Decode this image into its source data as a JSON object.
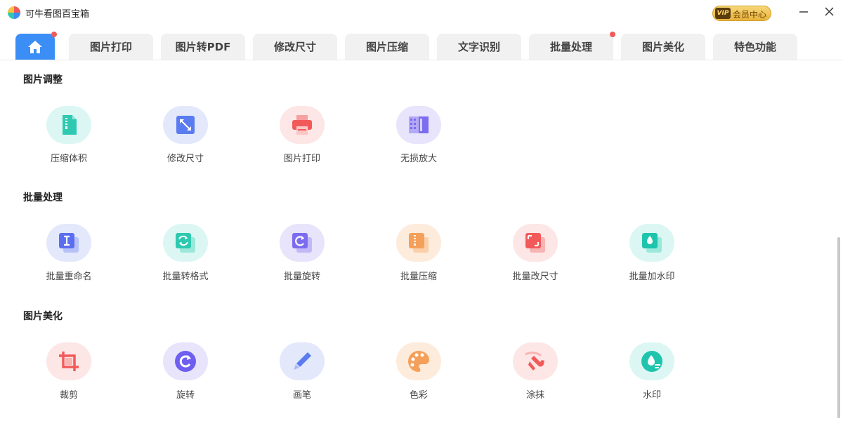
{
  "app": {
    "title": "可牛看图百宝箱",
    "logo": "pinwheel-logo"
  },
  "vip": {
    "badge": "VIP",
    "label": "会员中心"
  },
  "window": {
    "minimize_icon": "minimize-icon",
    "close_icon": "close-icon"
  },
  "tabs": [
    {
      "label": "",
      "icon": "home-icon",
      "active": true,
      "dot": true
    },
    {
      "label": "图片打印"
    },
    {
      "label": "图片转PDF"
    },
    {
      "label": "修改尺寸"
    },
    {
      "label": "图片压缩"
    },
    {
      "label": "文字识别"
    },
    {
      "label": "批量处理",
      "dot": true
    },
    {
      "label": "图片美化"
    },
    {
      "label": "特色功能"
    }
  ],
  "sections": [
    {
      "title": "图片调整",
      "tools": [
        {
          "label": "压缩体积",
          "icon": "zip-file-icon",
          "bg": "#dcf7f3",
          "color": "#2ec9b0"
        },
        {
          "label": "修改尺寸",
          "icon": "resize-icon",
          "bg": "#e3e8fb",
          "color": "#5b7cf0"
        },
        {
          "label": "图片打印",
          "icon": "printer-icon",
          "bg": "#fde6e6",
          "color": "#f25a5a"
        },
        {
          "label": "无损放大",
          "icon": "enlarge-icon",
          "bg": "#e7e4fb",
          "color": "#7b6cf0"
        }
      ]
    },
    {
      "title": "批量处理",
      "tools": [
        {
          "label": "批量重命名",
          "icon": "rename-icon",
          "bg": "#e3e8fb",
          "color": "#5b6ef0"
        },
        {
          "label": "批量转格式",
          "icon": "convert-icon",
          "bg": "#dcf7f3",
          "color": "#2ec9b0"
        },
        {
          "label": "批量旋转",
          "icon": "batch-rotate-icon",
          "bg": "#e7e4fb",
          "color": "#7b6cf0"
        },
        {
          "label": "批量压缩",
          "icon": "batch-compress-icon",
          "bg": "#fdebdc",
          "color": "#f5a05a"
        },
        {
          "label": "批量改尺寸",
          "icon": "batch-resize-icon",
          "bg": "#fde6e6",
          "color": "#f25a5a"
        },
        {
          "label": "批量加水印",
          "icon": "batch-watermark-icon",
          "bg": "#dcf7f3",
          "color": "#1fc4ad"
        }
      ]
    },
    {
      "title": "图片美化",
      "tools": [
        {
          "label": "裁剪",
          "icon": "crop-icon",
          "bg": "#fde6e6",
          "color": "#f25a5a"
        },
        {
          "label": "旋转",
          "icon": "rotate-icon",
          "bg": "#e7e4fb",
          "color": "#6e5ff0"
        },
        {
          "label": "画笔",
          "icon": "brush-icon",
          "bg": "#e3e8fb",
          "color": "#5b7cf0"
        },
        {
          "label": "色彩",
          "icon": "palette-icon",
          "bg": "#fdebdc",
          "color": "#f5a05a"
        },
        {
          "label": "涂抹",
          "icon": "smudge-icon",
          "bg": "#fde6e6",
          "color": "#f25a5a"
        },
        {
          "label": "水印",
          "icon": "watermark-icon",
          "bg": "#dcf7f3",
          "color": "#1fc4ad"
        }
      ]
    }
  ]
}
